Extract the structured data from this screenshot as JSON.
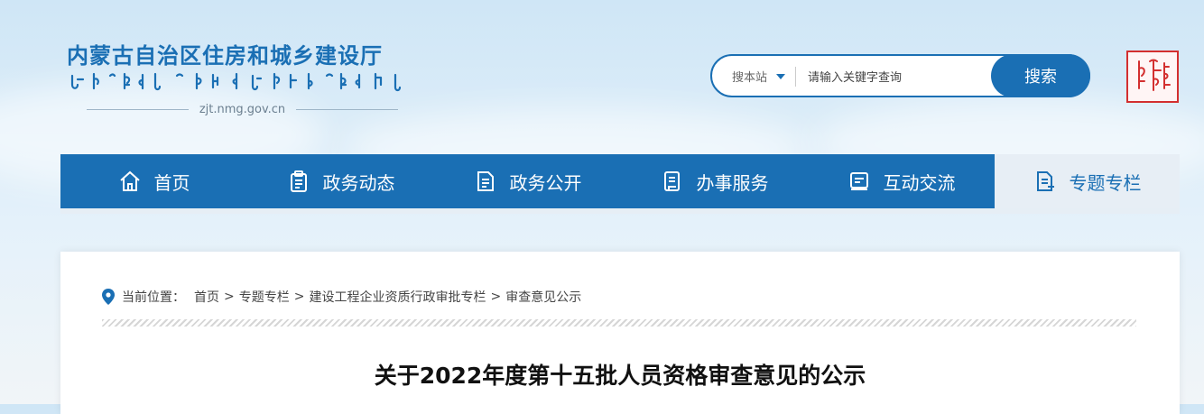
{
  "header": {
    "org_title": "内蒙古自治区住房和城乡建设厅",
    "site_url": "zjt.nmg.gov.cn"
  },
  "search": {
    "scope_label": "搜本站",
    "placeholder": "请输入关键字查询",
    "value": "",
    "button_label": "搜索"
  },
  "nav": {
    "items": [
      {
        "label": "首页",
        "icon": "home-icon"
      },
      {
        "label": "政务动态",
        "icon": "clipboard-icon"
      },
      {
        "label": "政务公开",
        "icon": "document-icon"
      },
      {
        "label": "办事服务",
        "icon": "service-icon"
      },
      {
        "label": "互动交流",
        "icon": "chat-icon"
      },
      {
        "label": "专题专栏",
        "icon": "column-icon",
        "active": true
      }
    ]
  },
  "breadcrumb": {
    "prefix": "当前位置：",
    "items": [
      "首页",
      "专题专栏",
      "建设工程企业资质行政审批专栏",
      "审查意见公示"
    ],
    "separator": ">"
  },
  "article": {
    "title": "关于2022年度第十五批人员资格审查意见的公示"
  },
  "colors": {
    "brand_blue": "#1a6fb4",
    "seal_red": "#d32f2f"
  }
}
